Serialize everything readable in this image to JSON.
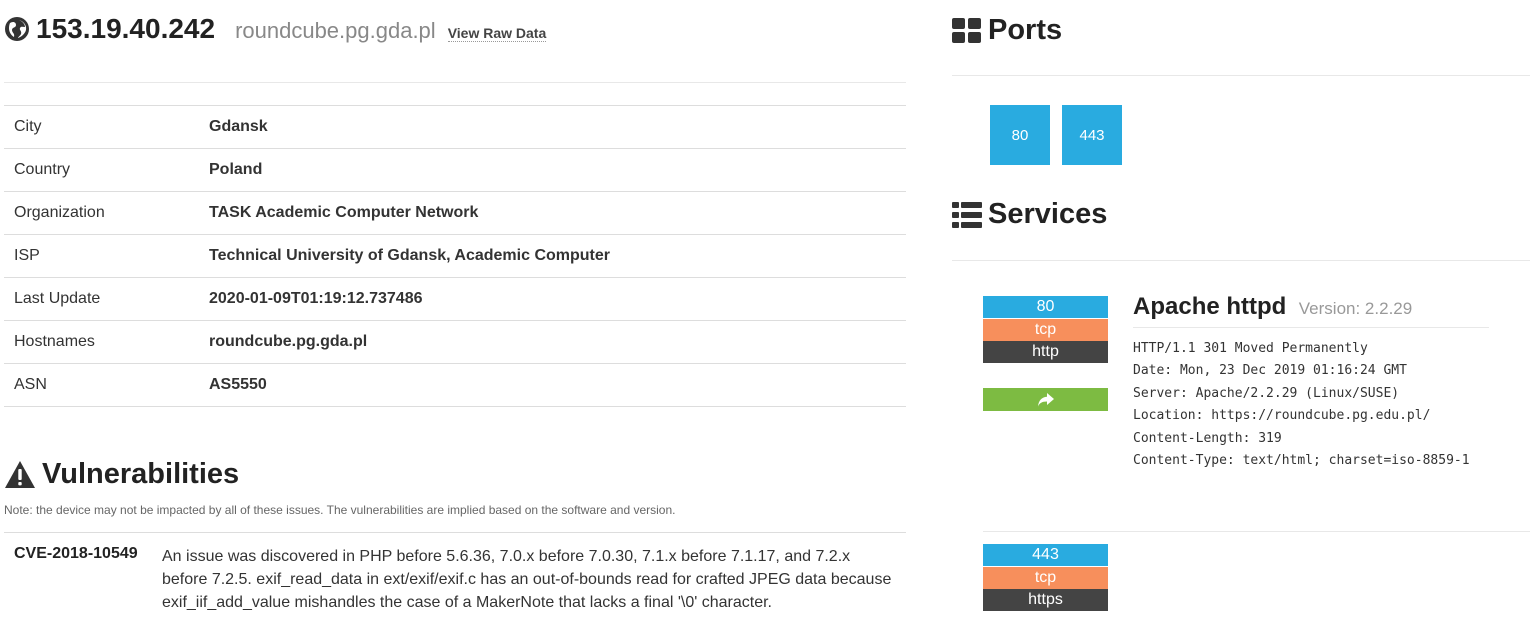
{
  "host": {
    "ip": "153.19.40.242",
    "hostname": "roundcube.pg.gda.pl",
    "raw_data_label": "View Raw Data"
  },
  "info_table": [
    {
      "key": "City",
      "value": "Gdansk"
    },
    {
      "key": "Country",
      "value": "Poland"
    },
    {
      "key": "Organization",
      "value": "TASK Academic Computer Network"
    },
    {
      "key": "ISP",
      "value": "Technical University of Gdansk, Academic Computer"
    },
    {
      "key": "Last Update",
      "value": "2020-01-09T01:19:12.737486"
    },
    {
      "key": "Hostnames",
      "value": "roundcube.pg.gda.pl"
    },
    {
      "key": "ASN",
      "value": "AS5550"
    }
  ],
  "vulnerabilities": {
    "title": "Vulnerabilities",
    "note": "Note: the device may not be impacted by all of these issues. The vulnerabilities are implied based on the software and version.",
    "items": [
      {
        "id": "CVE-2018-10549",
        "description": "An issue was discovered in PHP before 5.6.36, 7.0.x before 7.0.30, 7.1.x before 7.1.17, and 7.2.x before 7.2.5. exif_read_data in ext/exif/exif.c has an out-of-bounds read for crafted JPEG data because exif_iif_add_value mishandles the case of a MakerNote that lacks a final '\\0' character."
      }
    ]
  },
  "ports": {
    "title": "Ports",
    "list": [
      "80",
      "443"
    ]
  },
  "services": {
    "title": "Services",
    "items": [
      {
        "port": "80",
        "protocol": "tcp",
        "name": "http",
        "product": "Apache httpd",
        "version_label": "Version: 2.2.29",
        "banner": "HTTP/1.1 301 Moved Permanently\nDate: Mon, 23 Dec 2019 01:16:24 GMT\nServer: Apache/2.2.29 (Linux/SUSE)\nLocation: https://roundcube.pg.edu.pl/\nContent-Length: 319\nContent-Type: text/html; charset=iso-8859-1"
      },
      {
        "port": "443",
        "protocol": "tcp",
        "name": "https"
      }
    ]
  },
  "colors": {
    "port_blue": "#29abe0",
    "protocol_orange": "#f78f5c",
    "service_dark": "#444444",
    "redirect_green": "#7dbb42"
  },
  "icons": {
    "header": "globe-icon",
    "vulnerabilities": "warning-triangle-icon",
    "ports": "grid-icon",
    "services": "list-icon",
    "redirect": "share-arrow-icon"
  }
}
